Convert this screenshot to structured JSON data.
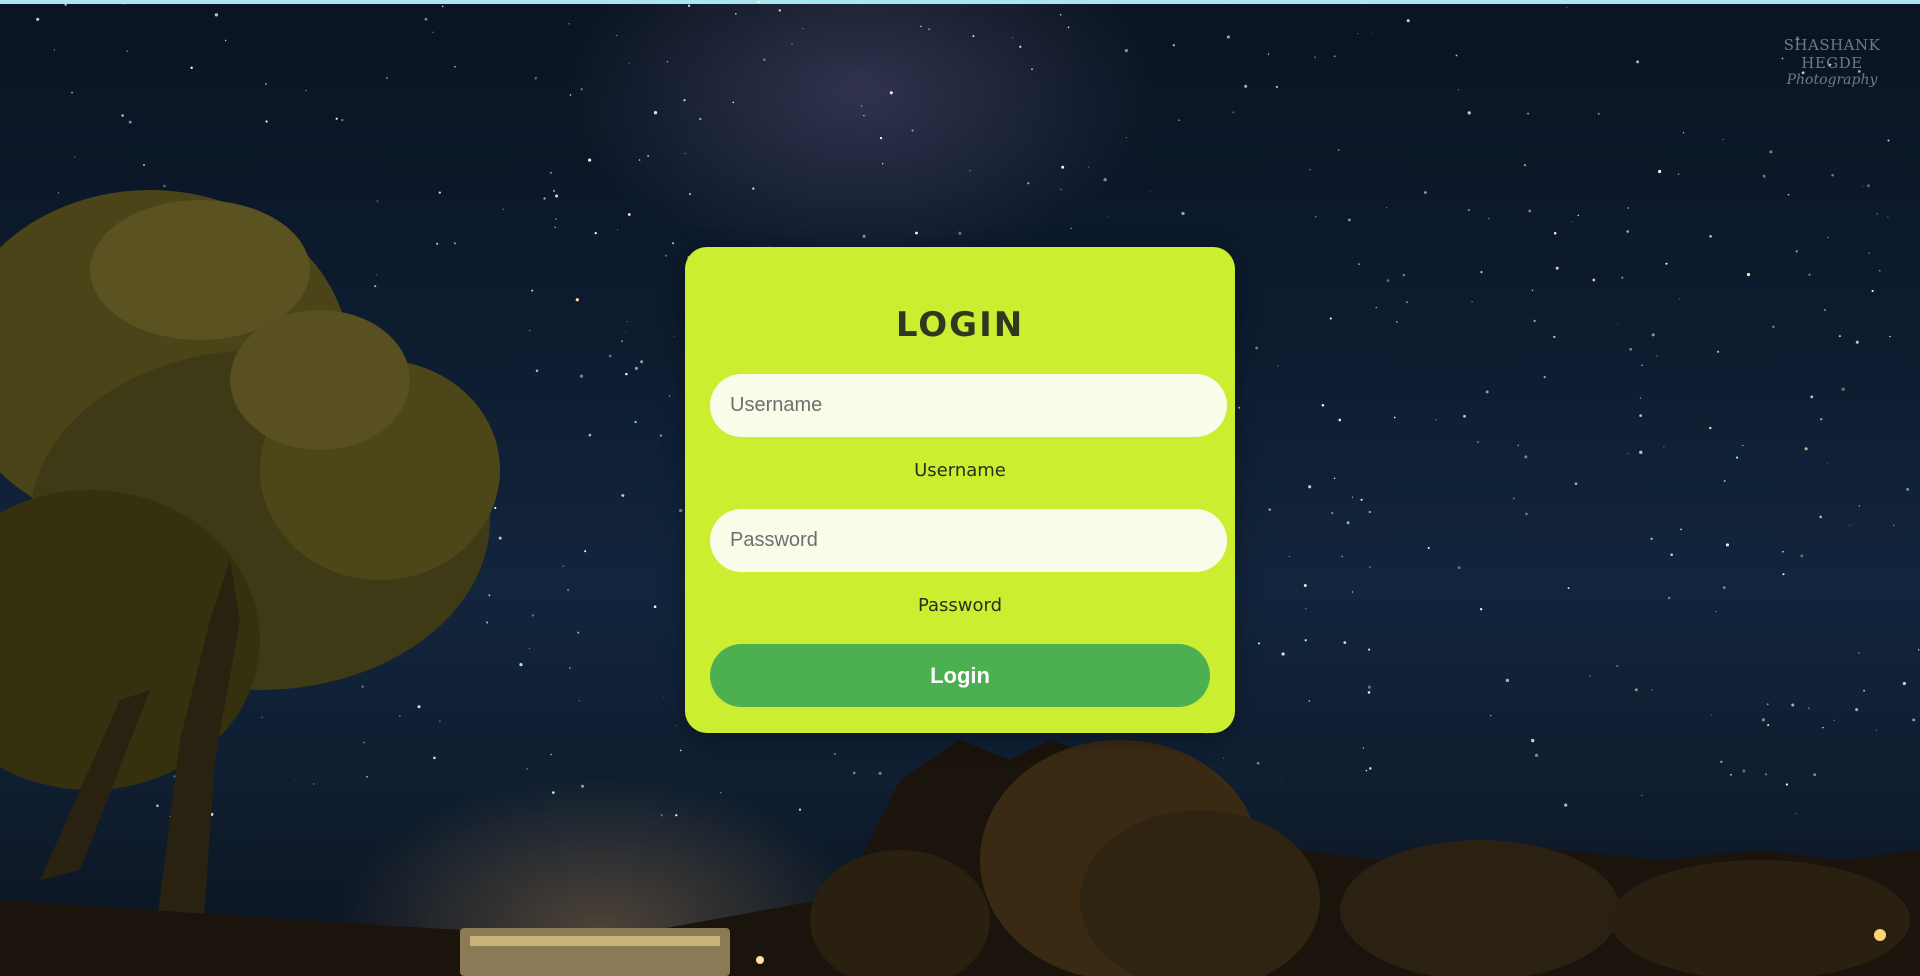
{
  "page": {
    "watermark_name": "SHASHANK HEGDE",
    "watermark_sub": "Photography"
  },
  "login": {
    "title": "LOGIN",
    "username_placeholder": "Username",
    "username_value": "",
    "username_label": "Username",
    "password_placeholder": "Password",
    "password_value": "",
    "password_label": "Password",
    "submit_label": "Login"
  },
  "colors": {
    "card_background": "#ccee31",
    "button_background": "#4caf50",
    "input_background": "#f8fce8",
    "top_strip": "#a9e6f0"
  }
}
